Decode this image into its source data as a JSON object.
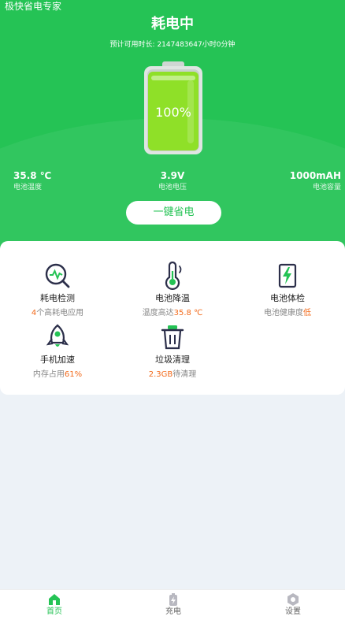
{
  "header": {
    "app_name": "极快省电专家",
    "status_title": "耗电中",
    "estimate_label": "预计可用时长: ",
    "estimate_value": "2147483647小时0分钟"
  },
  "battery": {
    "percent_text": "100%",
    "level": 1.0
  },
  "stats": {
    "temperature": {
      "value": "35.8 ℃",
      "label": "电池温度"
    },
    "voltage": {
      "value": "3.9V",
      "label": "电池电压"
    },
    "capacity": {
      "value": "1000mAH",
      "label": "电池容量"
    }
  },
  "save_button": {
    "label": "一键省电"
  },
  "features": [
    {
      "name": "耗电检测",
      "desc_hl": "4",
      "desc_rest": "个高耗电应用",
      "icon": "magnifier-pulse-icon"
    },
    {
      "name": "电池降温",
      "desc_rest": "温度高达",
      "desc_hl": "35.8 ℃",
      "icon": "thermometer-icon"
    },
    {
      "name": "电池体检",
      "desc_rest": "电池健康度",
      "desc_hl": "低",
      "icon": "battery-bolt-icon"
    },
    {
      "name": "手机加速",
      "desc_rest": "内存占用",
      "desc_hl": "61%",
      "icon": "rocket-icon"
    },
    {
      "name": "垃圾清理",
      "desc_hl": "2.3GB",
      "desc_rest": "待清理",
      "icon": "trash-icon"
    }
  ],
  "tabs": [
    {
      "label": "首页",
      "icon": "home-icon",
      "active": true
    },
    {
      "label": "充电",
      "icon": "charging-icon",
      "active": false
    },
    {
      "label": "设置",
      "icon": "settings-icon",
      "active": false
    }
  ],
  "colors": {
    "brand_green": "#25c355",
    "highlight_orange": "#f26a1b",
    "battery_fill": "#8fe028"
  }
}
